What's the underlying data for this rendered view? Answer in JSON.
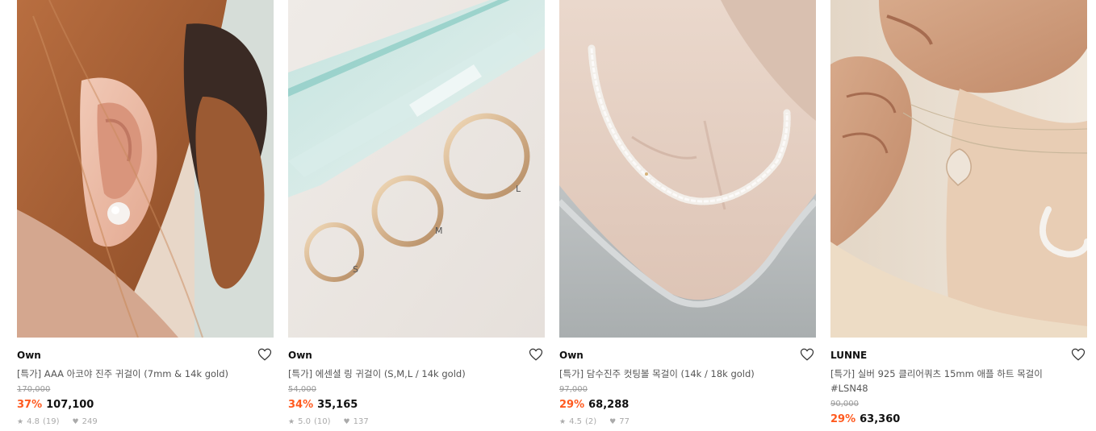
{
  "products": [
    {
      "brand": "Own",
      "title": "[특가] AAA 아코야 진주 귀걸이 (7mm & 14k gold)",
      "original_price": "170,000",
      "discount": "37%",
      "price": "107,100",
      "rating": "4.8",
      "review_count": "(19)",
      "likes": "249"
    },
    {
      "brand": "Own",
      "title": "[특가] 에센셜 링 귀걸이 (S,M,L / 14k gold)",
      "original_price": "54,000",
      "discount": "34%",
      "price": "35,165",
      "rating": "5.0",
      "review_count": "(10)",
      "likes": "137",
      "image_labels": {
        "s": "S",
        "m": "M",
        "l": "L"
      }
    },
    {
      "brand": "Own",
      "title": "[특가] 담수진주 컷팅볼 목걸이 (14k / 18k gold)",
      "original_price": "97,000",
      "discount": "29%",
      "price": "68,288",
      "rating": "4.5",
      "review_count": "(2)",
      "likes": "77"
    },
    {
      "brand": "LUNNE",
      "title": "[특가] 실버 925 클리어쿼츠 15mm 애플 하트 목걸이 #LSN48",
      "original_price": "90,000",
      "discount": "29%",
      "price": "63,360"
    }
  ],
  "icons": {
    "wishlist": "heart-outline-icon",
    "rating": "star-icon",
    "likes": "heart-filled-icon"
  },
  "colors": {
    "discount": "#ff5a1f",
    "price": "#111111",
    "original_price": "#999999"
  }
}
